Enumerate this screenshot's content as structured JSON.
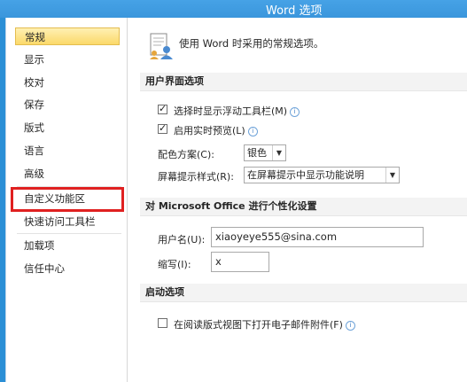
{
  "window": {
    "title": "Word 选项"
  },
  "sidebar": {
    "items": [
      {
        "label": "常规"
      },
      {
        "label": "显示"
      },
      {
        "label": "校对"
      },
      {
        "label": "保存"
      },
      {
        "label": "版式"
      },
      {
        "label": "语言"
      },
      {
        "label": "高级"
      },
      {
        "label": "自定义功能区"
      },
      {
        "label": "快速访问工具栏"
      },
      {
        "label": "加载项"
      },
      {
        "label": "信任中心"
      }
    ]
  },
  "main": {
    "intro": "使用 Word 时采用的常规选项。",
    "ui_section": {
      "header": "用户界面选项",
      "show_minitoolbar": "选择时显示浮动工具栏(M)",
      "live_preview": "启用实时预览(L)",
      "color_scheme_label": "配色方案(C):",
      "color_scheme_value": "银色",
      "tooltip_label": "屏幕提示样式(R):",
      "tooltip_value": "在屏幕提示中显示功能说明"
    },
    "personalize_section": {
      "header": "对 Microsoft Office 进行个性化设置",
      "username_label": "用户名(U):",
      "username_value": "xiaoyeye555@sina.com",
      "initials_label": "缩写(I):",
      "initials_value": "x"
    },
    "startup_section": {
      "header": "启动选项",
      "reading_view": "在阅读版式视图下打开电子邮件附件(F)"
    }
  }
}
